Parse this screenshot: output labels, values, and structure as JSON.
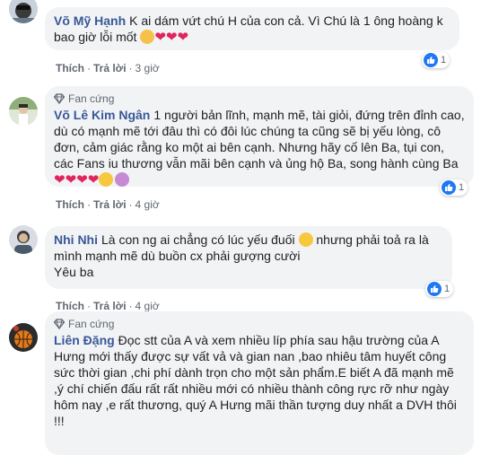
{
  "comments": [
    {
      "author": "Võ Mỹ Hạnh",
      "text": "K ai dám vứt chú H của con cả. Vì Chú là 1 ông hoàng k bao giờ lỗi mốt",
      "like_label": "Thích",
      "reply_label": "Trả lời",
      "time": "3 giờ",
      "reactions": "1"
    },
    {
      "badge": "Fan cứng",
      "author": "Võ Lê Kim Ngân",
      "text": "1 người bản lĩnh, mạnh mẽ, tài giỏi, đứng trên đỉnh cao, dù có mạnh mẽ tới đâu thì có đôi lúc chúng ta cũng sẽ bị yếu lòng, cô đơn, cảm giác rằng ko một ai bên cạnh. Nhưng hãy cố lên Ba, tụi con, các Fans iu thương vẫn mãi bên cạnh và ủng hộ Ba, song hành cùng Ba",
      "like_label": "Thích",
      "reply_label": "Trả lời",
      "time": "4 giờ",
      "reactions": "1"
    },
    {
      "author": "Nhi Nhi",
      "text_a": "Là con ng ai chẳng có lúc yếu đuối",
      "text_b": "nhưng phải toả ra là mình mạnh mẽ dù buồn cx phải gượng cười",
      "text_c": "Yêu ba",
      "like_label": "Thích",
      "reply_label": "Trả lời",
      "time": "4 giờ",
      "reactions": "1"
    },
    {
      "badge": "Fan cứng",
      "author": "Liên Đặng",
      "text": "Đọc stt của A và xem nhiều líp phía sau hậu trường của A Hưng mới thấy được sự vất vả và gian nan ,bao nhiêu tâm huyết công sức thời gian ,chi phí dành trọn cho một sản phẩm.E biết A đã mạnh mẽ ,ý chí chiến đấu rất rất nhiều mới có nhiều thành công rực rỡ như ngày hôm nay ,e rất thương, quý A Hưng mãi thần tượng duy nhất a DVH thôi !!!"
    }
  ]
}
